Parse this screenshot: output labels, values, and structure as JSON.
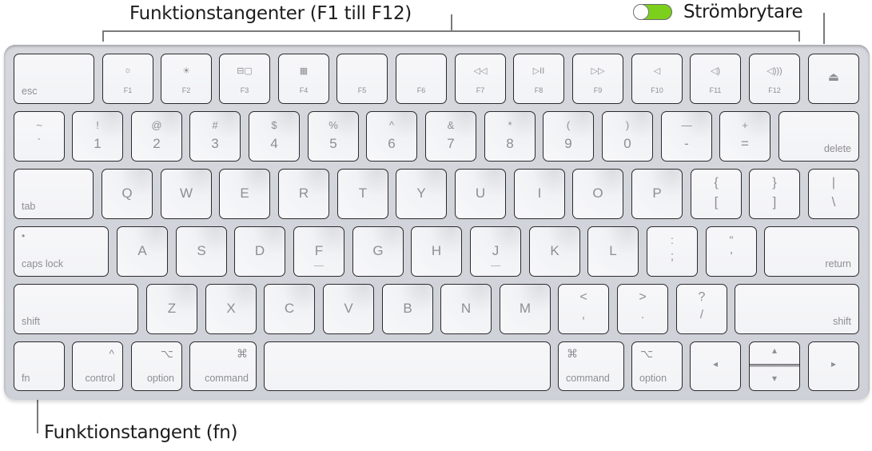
{
  "callouts": {
    "function_keys": "Funktionstangenter (F1 till F12)",
    "power_switch": "Strömbrytare",
    "fn_key": "Funktionstangent (fn)"
  },
  "toggle": {
    "state": "on",
    "color": "#7ccf1a"
  },
  "keys": {
    "esc": "esc",
    "f_row": [
      {
        "icon": "☼",
        "label": "F1"
      },
      {
        "icon": "☀",
        "label": "F2"
      },
      {
        "icon": "⊟▢",
        "label": "F3"
      },
      {
        "icon": "▦",
        "label": "F4"
      },
      {
        "icon": "",
        "label": "F5"
      },
      {
        "icon": "",
        "label": "F6"
      },
      {
        "icon": "◁◁",
        "label": "F7"
      },
      {
        "icon": "▷II",
        "label": "F8"
      },
      {
        "icon": "▷▷",
        "label": "F9"
      },
      {
        "icon": "◁",
        "label": "F10"
      },
      {
        "icon": "◁)",
        "label": "F11"
      },
      {
        "icon": "◁)))",
        "label": "F12"
      }
    ],
    "eject": "⏏",
    "number_row": [
      {
        "top": "~",
        "bottom": "`"
      },
      {
        "top": "!",
        "bottom": "1"
      },
      {
        "top": "@",
        "bottom": "2"
      },
      {
        "top": "#",
        "bottom": "3"
      },
      {
        "top": "$",
        "bottom": "4"
      },
      {
        "top": "%",
        "bottom": "5"
      },
      {
        "top": "^",
        "bottom": "6"
      },
      {
        "top": "&",
        "bottom": "7"
      },
      {
        "top": "*",
        "bottom": "8"
      },
      {
        "top": "(",
        "bottom": "9"
      },
      {
        "top": ")",
        "bottom": "0"
      },
      {
        "top": "—",
        "bottom": "-"
      },
      {
        "top": "+",
        "bottom": "="
      }
    ],
    "delete": "delete",
    "tab": "tab",
    "qwerty_row": [
      "Q",
      "W",
      "E",
      "R",
      "T",
      "Y",
      "U",
      "I",
      "O",
      "P"
    ],
    "bracket_open": {
      "top": "{",
      "bottom": "["
    },
    "bracket_close": {
      "top": "}",
      "bottom": "]"
    },
    "backslash": {
      "top": "|",
      "bottom": "\\"
    },
    "caps_lock": "caps lock",
    "caps_dot": "•",
    "home_row": [
      "A",
      "S",
      "D",
      "F",
      "G",
      "H",
      "J",
      "K",
      "L"
    ],
    "semicolon": {
      "top": ":",
      "bottom": ";"
    },
    "quote": {
      "top": "\"",
      "bottom": "'"
    },
    "return": "return",
    "shift_left": "shift",
    "bottom_letters": [
      "Z",
      "X",
      "C",
      "V",
      "B",
      "N",
      "M"
    ],
    "comma": {
      "top": "<",
      "bottom": ","
    },
    "period": {
      "top": ">",
      "bottom": "."
    },
    "slash": {
      "top": "?",
      "bottom": "/"
    },
    "shift_right": "shift",
    "fn": "fn",
    "control": {
      "label": "control",
      "symbol": "^"
    },
    "option_left": {
      "label": "option",
      "symbol": "⌥"
    },
    "command_left": {
      "label": "command",
      "symbol": "⌘"
    },
    "command_right": {
      "label": "command",
      "symbol": "⌘"
    },
    "option_right": {
      "label": "option",
      "symbol": "⌥"
    },
    "arrow_left": "◂",
    "arrow_up": "▴",
    "arrow_down": "▾",
    "arrow_right": "▸"
  }
}
